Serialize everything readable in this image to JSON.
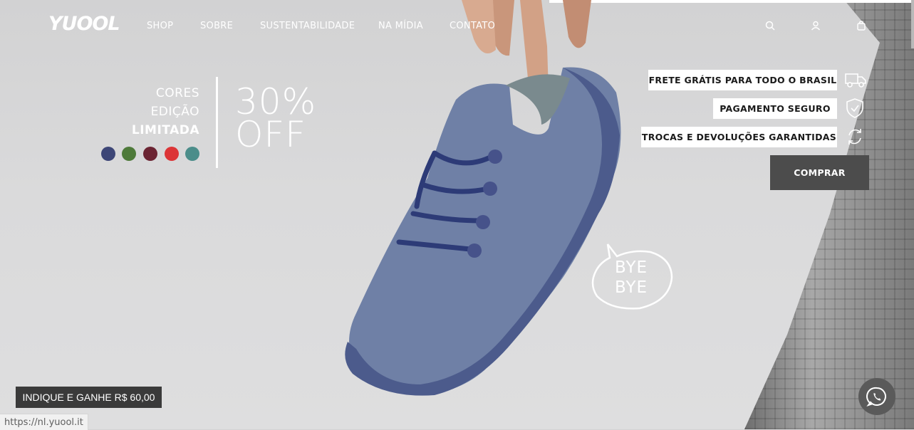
{
  "brand": {
    "logo_text": "YUOOL"
  },
  "nav": {
    "items": [
      "SHOP",
      "SOBRE",
      "SUSTENTABILIDADE",
      "NA MÍDIA",
      "CONTATO"
    ],
    "icons": [
      "search-icon",
      "user-icon",
      "cart-icon"
    ]
  },
  "promo": {
    "line1": "CORES",
    "line2": "EDIÇÃO",
    "line3": "LIMITADA",
    "percent": "30%",
    "off": "OFF",
    "swatch_colors": [
      "#3d4677",
      "#4e7a3a",
      "#6b2433",
      "#dc3537",
      "#4b8d8a"
    ]
  },
  "benefits": [
    {
      "label": "FRETE GRÁTIS PARA TODO O BRASIL",
      "icon": "truck-icon"
    },
    {
      "label": "PAGAMENTO SEGURO",
      "icon": "shield-icon"
    },
    {
      "label": "TROCAS E DEVOLUÇÕES GARANTIDAS",
      "icon": "refresh-icon"
    }
  ],
  "cta": {
    "label": "COMPRAR"
  },
  "bubble": {
    "line1": "BYE",
    "line2": "BYE"
  },
  "referral": {
    "label": "INDIQUE E GANHE R$ 60,00"
  },
  "status_bar": {
    "url": "https://nl.yuool.it"
  },
  "colors": {
    "cta_bg": "#4c4c4c",
    "referral_bg": "#3a3a3a",
    "whatsapp_bg": "#5a5a5a"
  }
}
